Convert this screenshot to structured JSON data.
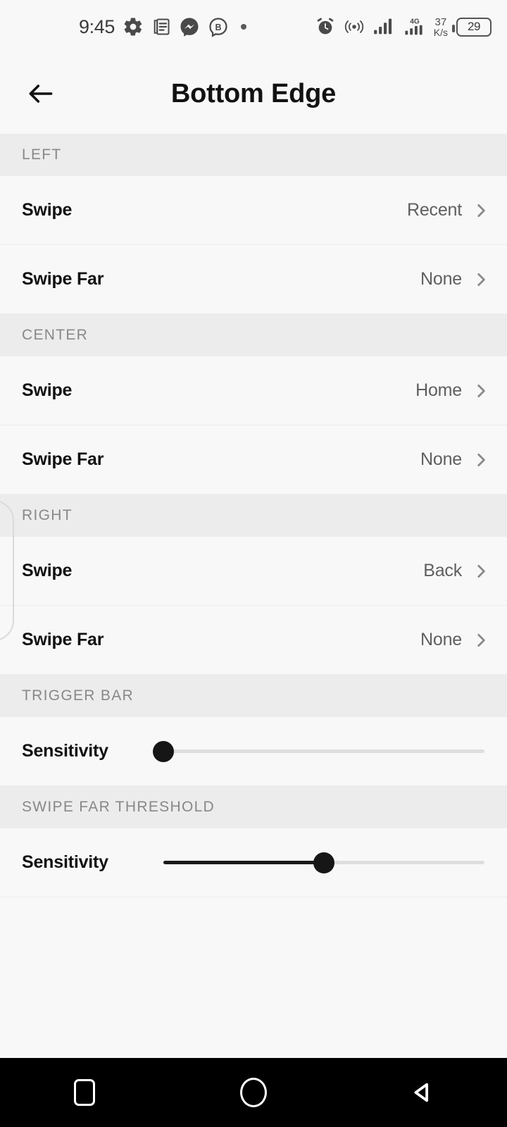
{
  "statusbar": {
    "time": "9:45",
    "left_icons": [
      "gear-icon",
      "document-icon",
      "messenger-icon",
      "b-badge-icon",
      "dot-icon"
    ],
    "right_icons": [
      "alarm-icon",
      "hotspot-icon",
      "signal-icon",
      "signal-4g-icon"
    ],
    "network_speed_value": "37",
    "network_speed_unit": "K/s",
    "mobile_network_label": "4G",
    "battery_level": "29"
  },
  "appbar": {
    "back_icon": "arrow-left-icon",
    "title": "Bottom Edge"
  },
  "sections": [
    {
      "header": "LEFT",
      "rows": [
        {
          "label": "Swipe",
          "value": "Recent"
        },
        {
          "label": "Swipe Far",
          "value": "None"
        }
      ]
    },
    {
      "header": "CENTER",
      "rows": [
        {
          "label": "Swipe",
          "value": "Home"
        },
        {
          "label": "Swipe Far",
          "value": "None"
        }
      ]
    },
    {
      "header": "RIGHT",
      "rows": [
        {
          "label": "Swipe",
          "value": "Back"
        },
        {
          "label": "Swipe Far",
          "value": "None"
        }
      ]
    }
  ],
  "trigger_bar": {
    "header": "TRIGGER BAR",
    "slider_label": "Sensitivity",
    "slider_percent": 0
  },
  "swipe_far_threshold": {
    "header": "SWIPE FAR THRESHOLD",
    "slider_label": "Sensitivity",
    "slider_percent": 50
  },
  "navbar": {
    "recents_icon": "square-icon",
    "home_icon": "circle-icon",
    "back_icon": "triangle-back-icon"
  },
  "colors": {
    "page_background": "#f8f8f8",
    "section_header_background": "#ececec",
    "section_header_text": "#888888",
    "row_label_text": "#111111",
    "row_value_text": "#5f5f5f",
    "divider": "#ededed",
    "slider_active": "#1a1a1a",
    "slider_track": "#dedede",
    "navbar_background": "#000000"
  }
}
